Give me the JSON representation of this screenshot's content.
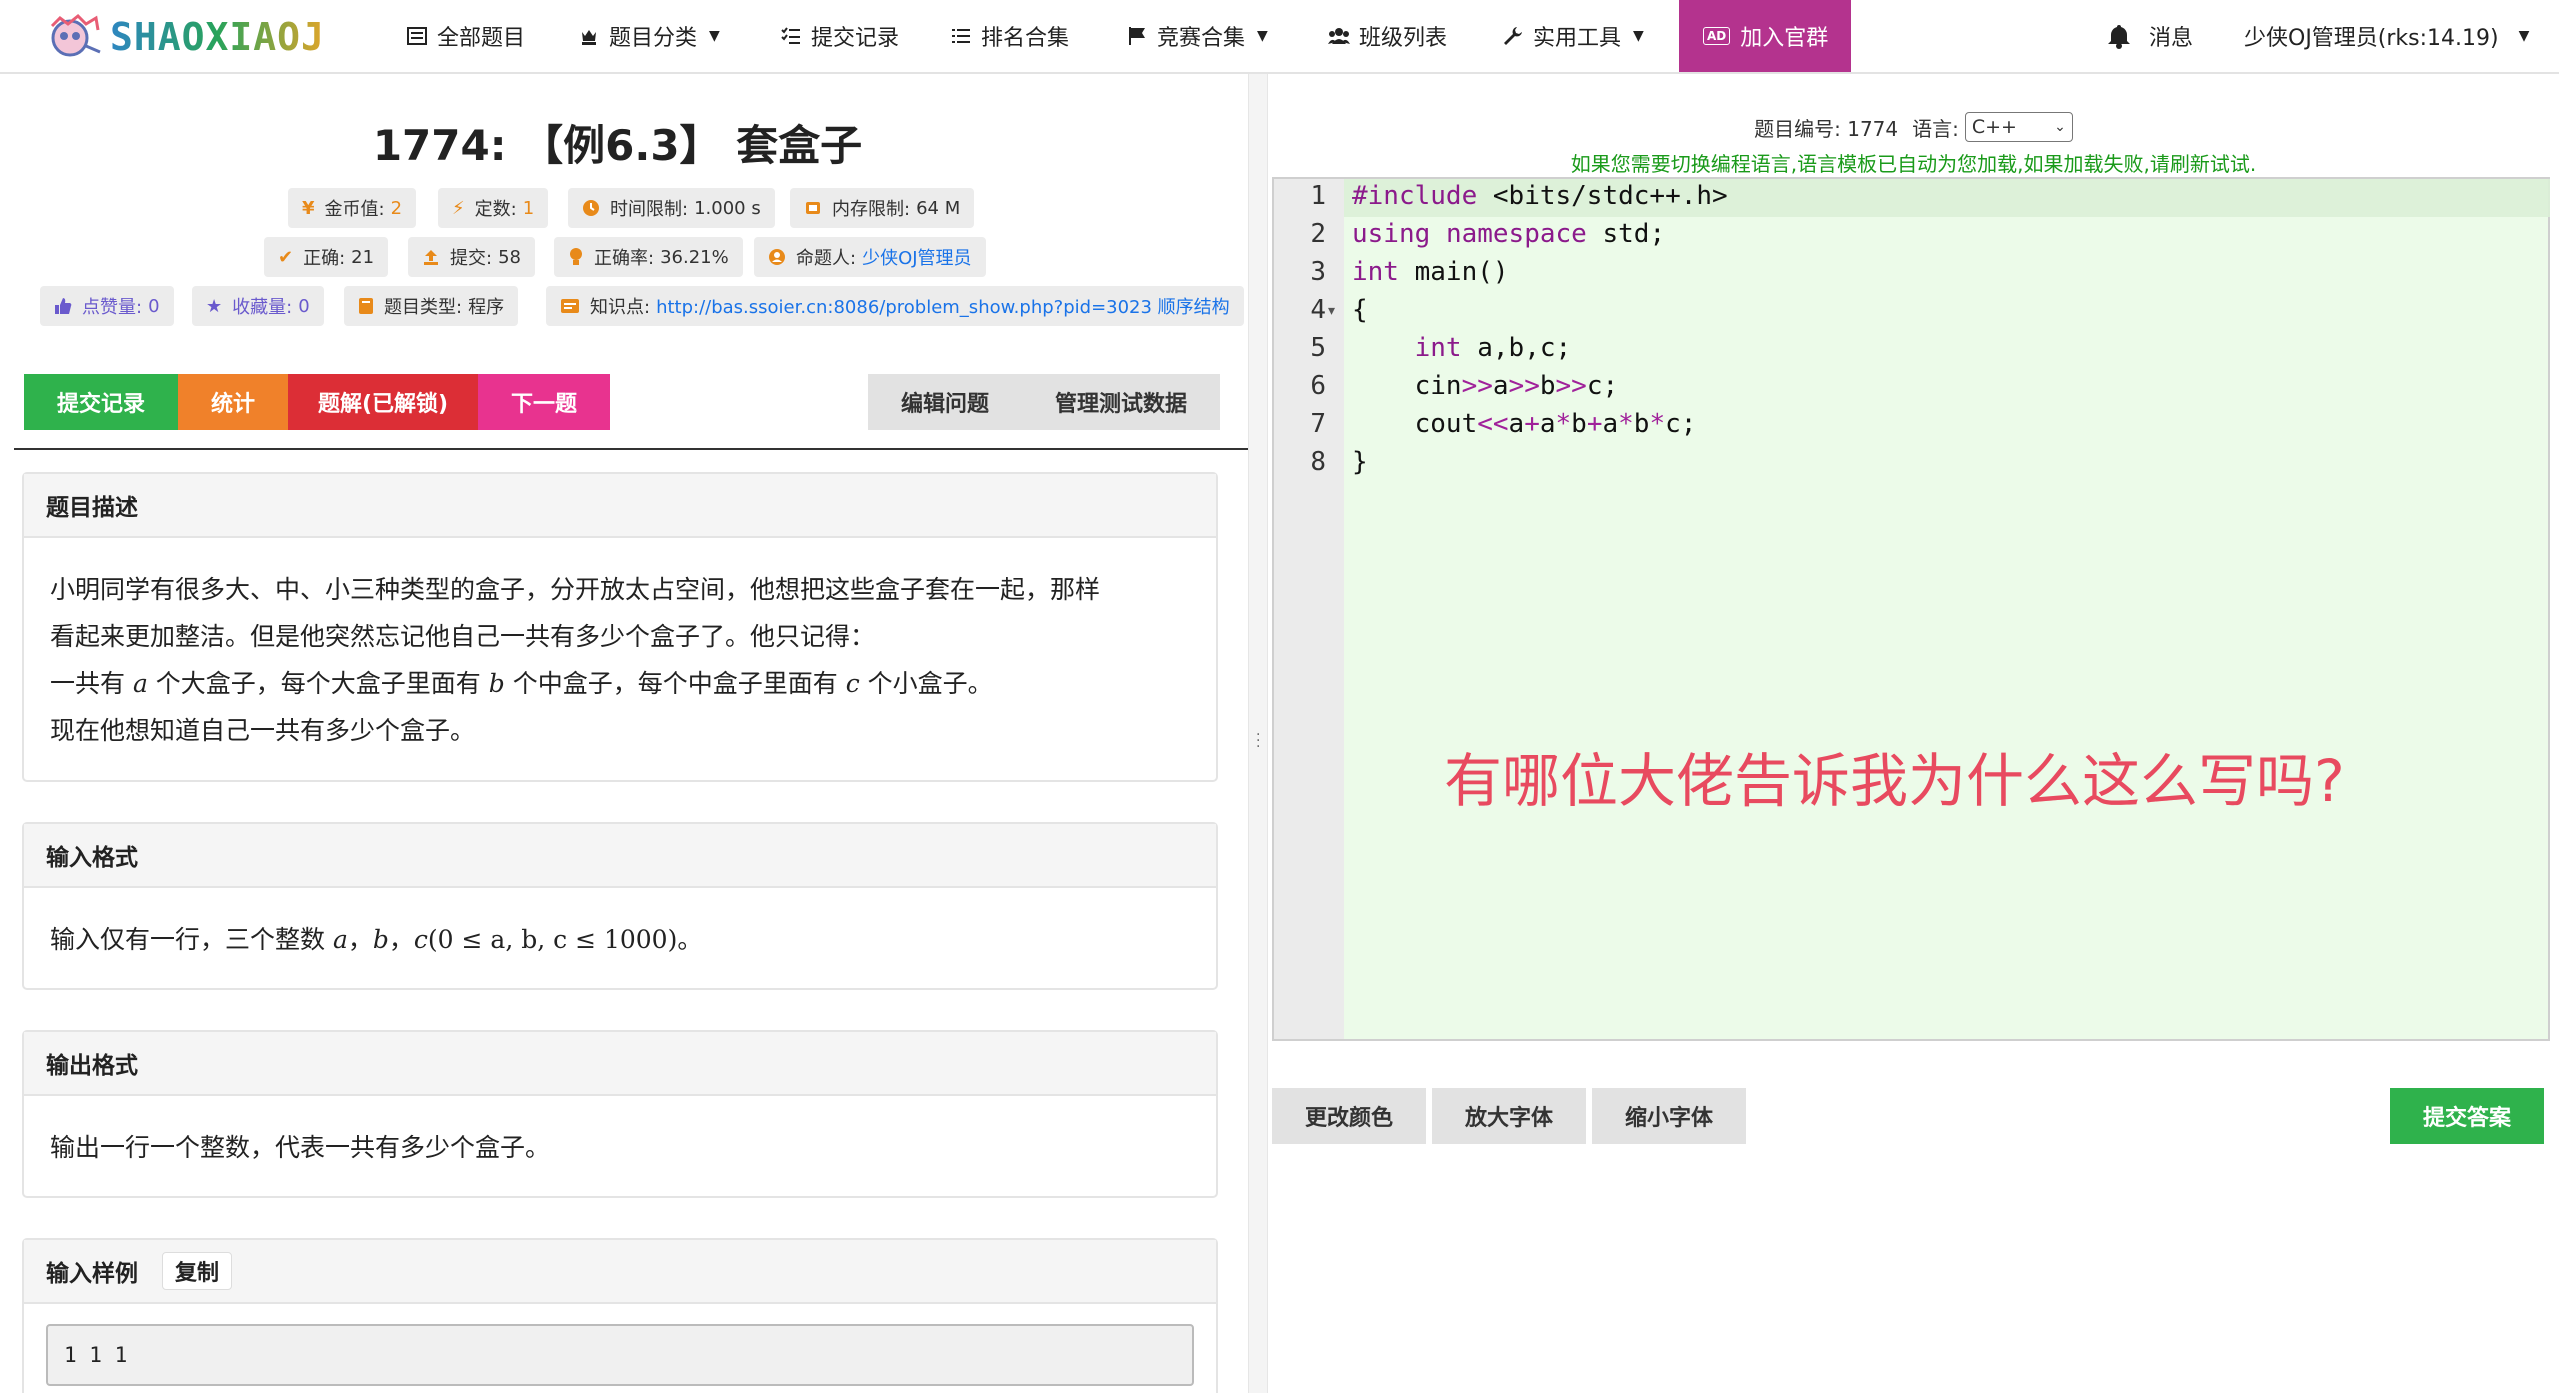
{
  "brand": {
    "logo_text": "SHAOXIAOJ"
  },
  "nav": {
    "all_problems": "全部题目",
    "categories": "题目分类",
    "submissions": "提交记录",
    "rankings": "排名合集",
    "contests": "竞赛合集",
    "classes": "班级列表",
    "tools": "实用工具",
    "ad_badge": "AD",
    "join_group": "加入官群",
    "messages": "消息",
    "user": "少侠OJ管理员(rks:14.19)"
  },
  "problem": {
    "title": "1774: 【例6.3】 套盒子",
    "stats_row1": {
      "coins_label": "金币值:",
      "coins_value": "2",
      "points_label": "定数:",
      "points_value": "1",
      "time_label": "时间限制:",
      "time_value": "1.000 s",
      "memory_label": "内存限制:",
      "memory_value": "64 M"
    },
    "stats_row2": {
      "correct_label": "正确:",
      "correct_value": "21",
      "submit_label": "提交:",
      "submit_value": "58",
      "rate_label": "正确率:",
      "rate_value": "36.21%",
      "author_label": "命题人:",
      "author_value": "少侠OJ管理员"
    },
    "stats_row3": {
      "likes_label": "点赞量:",
      "likes_value": "0",
      "favs_label": "收藏量:",
      "favs_value": "0",
      "type_label": "题目类型:",
      "type_value": "程序",
      "knowledge_label": "知识点:",
      "knowledge_value": "http://bas.ssoier.cn:8086/problem_show.php?pid=3023 顺序结构"
    },
    "actions": {
      "submit_record": "提交记录",
      "stats": "统计",
      "solution": "题解(已解锁)",
      "next": "下一题",
      "edit": "编辑问题",
      "manage_data": "管理测试数据"
    },
    "description": {
      "head": "题目描述",
      "line1": "小明同学有很多大、中、小三种类型的盒子，分开放太占空间，他想把这些盒子套在一起，那样",
      "line2": "看起来更加整洁。但是他突然忘记他自己一共有多少个盒子了。他只记得：",
      "line3_a": "一共有 ",
      "var_a": "a",
      "line3_b": " 个大盒子，每个大盒子里面有 ",
      "var_b": "b",
      "line3_c": " 个中盒子，每个中盒子里面有 ",
      "var_c": "c",
      "line3_d": " 个小盒子。",
      "line4": "现在他想知道自己一共有多少个盒子。"
    },
    "input_format": {
      "head": "输入格式",
      "text_a": "输入仅有一行，三个整数 ",
      "var_a": "a",
      "sep1": "，",
      "var_b": "b",
      "sep2": "，",
      "var_c": "c",
      "range": "(0 ≤ a, b, c ≤ 1000)",
      "tail": "。"
    },
    "output_format": {
      "head": "输出格式",
      "text": "输出一行一个整数，代表一共有多少个盒子。"
    },
    "sample_input": {
      "head": "输入样例",
      "copy": "复制",
      "value": "1 1 1"
    }
  },
  "editor": {
    "problem_no_label": "题目编号: 1774",
    "lang_label": "语言:",
    "lang_value": "C++",
    "hint": "如果您需要切换编程语言,语言模板已自动为您加载,如果加载失败,请刷新试试.",
    "line_numbers": [
      "1",
      "2",
      "3",
      "4",
      "5",
      "6",
      "7",
      "8"
    ],
    "code": {
      "l1_kw": "#include",
      "l1_rest": " <bits/stdc++.h>",
      "l2_kw1": "using",
      "l2_sp": " ",
      "l2_kw2": "namespace",
      "l2_rest": " std;",
      "l3_kw": "int",
      "l3_rest": " main()",
      "l4": "{",
      "l5_indent": "    ",
      "l5_kw": "int",
      "l5_rest": " a,b,c;",
      "l6_a": "    cin",
      "l6_op1": ">>",
      "l6_b": "a",
      "l6_op2": ">>",
      "l6_c": "b",
      "l6_op3": ">>",
      "l6_d": "c;",
      "l7_a": "    cout",
      "l7_op1": "<<",
      "l7_b": "a",
      "l7_op2": "+",
      "l7_c": "a",
      "l7_op3": "*",
      "l7_d": "b",
      "l7_op4": "+",
      "l7_e": "a",
      "l7_op5": "*",
      "l7_f": "b",
      "l7_op6": "*",
      "l7_g": "c;",
      "l8": "}"
    },
    "overlay_question": "有哪位大佬告诉我为什么这么写吗?",
    "buttons": {
      "change_color": "更改颜色",
      "zoom_in": "放大字体",
      "zoom_out": "缩小字体",
      "submit": "提交答案"
    }
  },
  "colors": {
    "green_btn": "#2fb24c",
    "orange_btn": "#f0812a",
    "red_btn": "#dc2e36",
    "pink_btn": "#e8338f",
    "ad_bg": "#b4338e",
    "editor_bg": "#ecfbe9",
    "overlay_text": "#e84a5f"
  }
}
